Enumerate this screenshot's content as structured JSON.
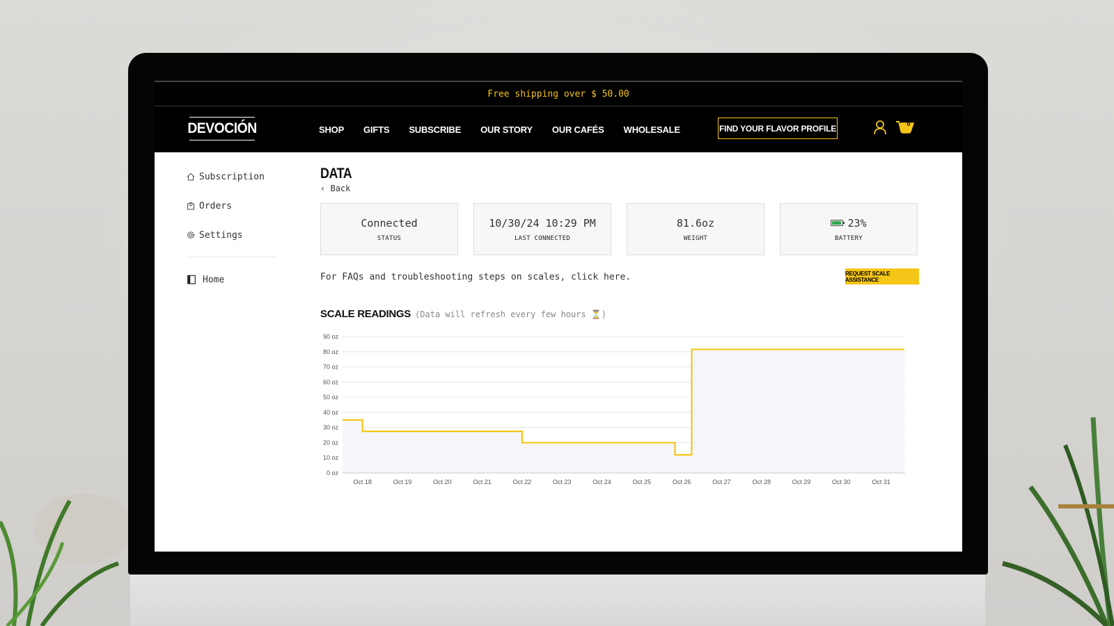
{
  "banner": {
    "text": "Free shipping over $ 50.00"
  },
  "nav": {
    "logo": "DEVOCIÓN",
    "items": [
      "SHOP",
      "GIFTS",
      "SUBSCRIBE",
      "OUR STORY",
      "OUR CAFÉS",
      "WHOLESALE"
    ],
    "flavor_button": "FIND YOUR FLAVOR PROFILE",
    "cart_count": "0"
  },
  "sidebar": {
    "items": [
      {
        "label": "Subscription",
        "icon": "home-icon"
      },
      {
        "label": "Orders",
        "icon": "bag-icon"
      },
      {
        "label": "Settings",
        "icon": "gear-icon"
      }
    ],
    "home": {
      "label": "Home",
      "icon": "book-icon"
    }
  },
  "main": {
    "title": "DATA",
    "back": "Back",
    "cards": [
      {
        "value": "Connected",
        "label": "STATUS"
      },
      {
        "value": "10/30/24 10:29 PM",
        "label": "LAST CONNECTED"
      },
      {
        "value": "81.6oz",
        "label": "WEIGHT"
      },
      {
        "value": "23%",
        "label": "BATTERY",
        "icon": "battery-icon"
      }
    ],
    "faq_text": "For FAQs and troubleshooting steps on scales, click here.",
    "assist_button": "REQUEST SCALE ASSISTANCE",
    "readings_title": "SCALE READINGS",
    "readings_note": "(Data will refresh every few hours ⏳)"
  },
  "colors": {
    "accent": "#f5c518",
    "black": "#000000",
    "fill": "#f5f6fa"
  },
  "chart_data": {
    "type": "line",
    "xlabel": "",
    "ylabel": "",
    "ylim": [
      0,
      90
    ],
    "yticks": [
      "0 oz",
      "10 oz",
      "20 oz",
      "30 oz",
      "40 oz",
      "50 oz",
      "60 oz",
      "70 oz",
      "80 oz",
      "90 oz"
    ],
    "xticks": [
      "Oct 18",
      "Oct 19",
      "Oct 20",
      "Oct 21",
      "Oct 22",
      "Oct 23",
      "Oct 24",
      "Oct 25",
      "Oct 26",
      "Oct 27",
      "Oct 28",
      "Oct 29",
      "Oct 30",
      "Oct 31"
    ],
    "step_points": [
      {
        "x": "Oct 17 12:00",
        "y": 35
      },
      {
        "x": "Oct 18 00:00",
        "y": 35
      },
      {
        "x": "Oct 18 00:00",
        "y": 27.5
      },
      {
        "x": "Oct 22 00:00",
        "y": 27.5
      },
      {
        "x": "Oct 22 00:00",
        "y": 20
      },
      {
        "x": "Oct 25 20:00",
        "y": 20
      },
      {
        "x": "Oct 25 20:00",
        "y": 12
      },
      {
        "x": "Oct 26 06:00",
        "y": 12
      },
      {
        "x": "Oct 26 06:00",
        "y": 81.6
      },
      {
        "x": "Oct 31 14:00",
        "y": 81.6
      }
    ]
  }
}
